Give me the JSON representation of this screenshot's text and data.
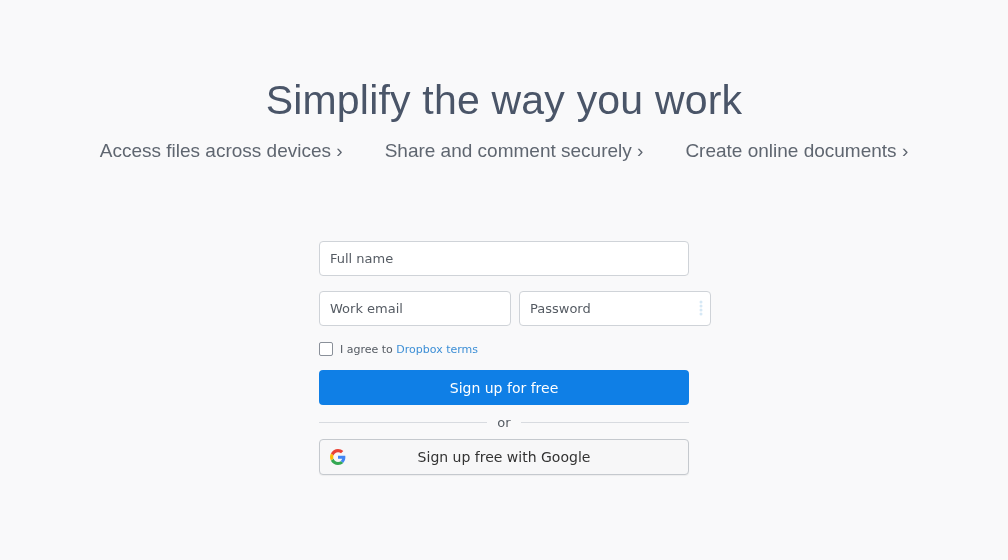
{
  "heading": "Simplify the way you work",
  "features": [
    {
      "label": "Access files across devices ›"
    },
    {
      "label": "Share and comment securely ›"
    },
    {
      "label": "Create online documents ›"
    }
  ],
  "form": {
    "full_name": {
      "placeholder": "Full name"
    },
    "email": {
      "placeholder": "Work email"
    },
    "password": {
      "placeholder": "Password"
    },
    "agree": {
      "checked": false,
      "text": "I agree to ",
      "link": "Dropbox terms"
    },
    "submit": "Sign up for free",
    "divider": "or",
    "google": "Sign up free with Google"
  }
}
